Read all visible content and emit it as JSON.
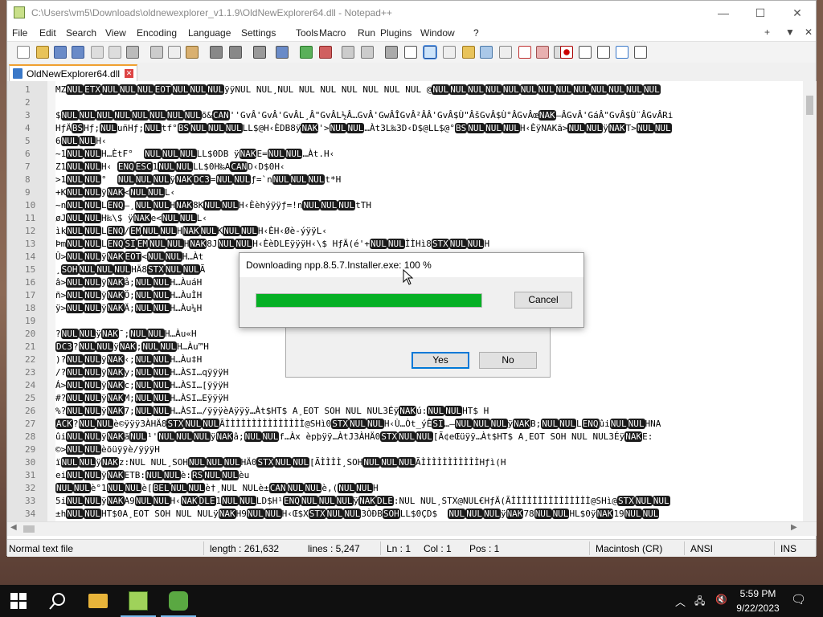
{
  "window": {
    "title": "C:\\Users\\vm5\\Downloads\\oldnewexplorer_v1.1.9\\OldNewExplorer64.dll - Notepad++"
  },
  "menu": [
    "File",
    "Edit",
    "Search",
    "View",
    "Encoding",
    "Language",
    "Settings",
    "Tools",
    "Macro",
    "Run",
    "Plugins",
    "Window",
    "?"
  ],
  "menu_right": [
    "+",
    "▼",
    "✕"
  ],
  "tab": {
    "label": "OldNewExplorer64.dll"
  },
  "editor": {
    "lines": [
      {
        "n": "1",
        "t": "MZ·NUL·ETX·NUL NUL NUL·EOT·NUL NUL NUL·ÿÿ·NUL NUL¸NUL NUL NUL NUL NUL NUL NUL @·NUL NUL NUL NUL NUL NUL NUL NUL NUL NUL NUL NUL NUL"
      },
      {
        "n": "2",
        "t": ""
      },
      {
        "n": "3",
        "t": "$·NUL NUL NUL NUL NUL NUL NUL NUL·õ&·CAN·''GvÂ'GvÂ'GvÂL¸Â\"GvÂL½Â…GvÂ'GwÂÎGvÂ²ÂÂ'GvÂ$Ù\"ÂšGvÂ$Ù°ÂGvÂœ·NAK·–ÂGvÂ'GáÂ\"GvÂ$Ù¨ÂGvÂRi"
      },
      {
        "n": "4",
        "t": "HƒÄ·BS·Hƒ;·NUL·uñHƒ;·NUL·tf°·BS·NUL NUL NUL·LL$@H‹ÈDB8ÿ·NAK·'>·NUL NUL·…Àt3L‰3D‹D$@LL$@°·BS·NUL NUL NUL·H‹ÈÿNAK·ã>·NUL NUL·ÿ·NAK·T>·NUL NUL"
      },
      {
        "n": "5",
        "t": "6·NUL NUL·H‹"
      },
      {
        "n": "6",
        "t": "~1·NUL NUL·H…ÈtF°  ·NUL NUL NUL·LL$0DB ÿ·NAK·E=·NUL NUL·…Àt.H‹"
      },
      {
        "n": "7",
        "t": "Z1·NUL NUL·H‹ ·ENQ ESC·1·NUL NUL·LL$0H‰A·CAN·D‹D$0H‹"
      },
      {
        "n": "8",
        "t": ">1·NUL NUL·°  ·NUL NUL NUL·ÿ·NAK DC3·=·NUL NUL·ƒ=`n·NUL NUL NUL·t*H"
      },
      {
        "n": "9",
        "t": "+K·NUL NUL·ÿ·NAK·<·NUL NUL·L‹"
      },
      {
        "n": "10",
        "t": "~n·NUL NUL·L·ENQ·–¸·NUL NUL·H·NAK·8K·NUL NUL·H‹Èèhýÿÿƒ=!n·NUL NUL NUL·tTH"
      },
      {
        "n": "11",
        "t": "øJ·NUL NUL·H‰\\$ ÿ·NAK·e<·NUL NUL·L‹"
      },
      {
        "n": "12",
        "t": "ìk·NUL NUL·L·ENQ·/·EM·NUL NUL·H·NAK NUL·K·NUL NUL·H‹ÈH‹Øè-ýÿÿL‹"
      },
      {
        "n": "13",
        "t": "Þm·NUL NUL·L·ENQ SI EM·NUL NUL·H·NAK·8J·NUL NUL·H‹ÈèDLE·ÿÿÿH‹\\$ HƒÄ(é'+·NUL NUL·ÌÌHì8·STX·NUL NUL·H"
      },
      {
        "n": "14",
        "t": "Û>·NUL NUL·ÿ·NAK EOT·<·NUL NUL·H…Àt"
      },
      {
        "n": "15",
        "t": "¸·SOH·NUL NUL NUL·HÄ8·STX·NUL NUL·Ã"
      },
      {
        "n": "16",
        "t": "â>·NUL NUL·ÿ·NAK·å;·NUL NUL·H…ÀuáH"
      },
      {
        "n": "17",
        "t": "ñ>·NUL NUL·ÿ·NAK·Ö;·NUL NUL·H…ÀuÌH"
      },
      {
        "n": "18",
        "t": "ÿ>·NUL NUL·ÿ·NAK·Ä;·NUL NUL·H…Àu¼H"
      },
      {
        "n": "19",
        "t": ""
      },
      {
        "n": "20",
        "t": "?·NUL NUL·ÿ·NAK·¯;·NUL NUL·H…Àu«H"
      },
      {
        "n": "21",
        "t": "DC3·?·NUL NUL·ÿ·NAK·;·NUL NUL·H…Àu™H"
      },
      {
        "n": "22",
        "t": ")?·NUL NUL·ÿ·NAK·‹;·NUL NUL·H…Àu‡H"
      },
      {
        "n": "23",
        "t": "/?·NUL NUL·ÿ·NAK·y;·NUL NUL·H…ÀSI…qÿÿÿH"
      },
      {
        "n": "24",
        "t": "Á>·NUL NUL·ÿ·NAK·c;·NUL NUL·H…ÀSI…[ÿÿÿH"
      },
      {
        "n": "25",
        "t": "#?·NUL NUL·ÿ·NAK·M;·NUL NUL·H…ÀSI…EÿÿÿH"
      },
      {
        "n": "26",
        "t": "%?·NUL NUL·ÿ·NAK·7;·NUL NUL·H…ÀSI…/ÿÿÿèAÿÿÿ…Àt$HT$ A¸EOT SOH NUL NUL·3Éÿ·NAK·ú:·NUL NUL·HT$ H"
      },
      {
        "n": "27",
        "t": "ACK·?·NUL NUL·è©ÿÿÿ3ÀHÄ8·STX NUL NUL·ÃÌÌÌÌÌÌÌÌÌÌÌÌÌÌÌ@SHì0·STX·NUL NUL·H‹Ù…Òt_ýÊ·SI·…–·NUL NUL NUL·ÿ·NAK·B;·NUL NUL·L·ENQ·ûi·NUL NUL·H·NA"
      },
      {
        "n": "28",
        "t": "ûi·NUL NUL·ÿ·NAK·ã·NUL·¹'·NUL NUL NUL·ÿ·NAK·â;·NUL NUL·f…Àx èpþÿÿ…ÀtJ3ÀHÄ0·STX NUL NUL·[Ã¢eŒüÿÿ…Àt$HT$ A¸EOT SOH NUL NUL·3Éÿ·NAK·E:"
      },
      {
        "n": "29",
        "t": "©>·NUL NUL·èõüÿÿè/ÿÿÿH"
      },
      {
        "n": "30",
        "t": "ï·NUL NUL·ÿ·NAK·z:·NUL NUL¸SOH·NUL NUL NUL·HÄ0·STX·NUL NUL·[ÃÌÌÌÌ¸SOH·NUL NUL NUL·ÃÌÌÌÌÌÌÌÌÌÌÌHƒì(H"
      },
      {
        "n": "31",
        "t": "ei·NUL NUL·ÿ·NAK·ETB:·NUL NUL·è:·RS·NUL NUL·èu"
      },
      {
        "n": "32",
        "t": "NUL NUL·è°1·NUL NUL·è[·BEL·NUL NUL·è†¸NUL NUL·è±·CAN·NUL NUL·è,(·NUL NUL·H"
      },
      {
        "n": "33",
        "t": "5i·NUL NUL·ÿ·NAK·A9·NUL NUL·H‹·NAK DLE·1·NUL NUL·LD$H¹·ENQ·NUL NUL NUL·ÿ·NAK DLE·:·NUL NUL¸STX·@NUL·€HƒÄ(ÃÌÌÌÌÌÌÌÌÌÌÌÌÌÌÌ@SHì@·STX·NUL NUL"
      },
      {
        "n": "34",
        "t": "±h·NUL NUL·HT$0A¸EOT SOH NUL NUL·ÿ·NAK·H9·NUL NUL·H‹Œ$X·STX·NUL NUL·3ÒÐB·SOH·LL$0ÇD$  ·NUL NUL NUL·ÿ·NAK·78·NUL NUL·HL$0ÿ·NAK·19·NUL NUL"
      }
    ]
  },
  "statusbar": {
    "type": "Normal text file",
    "length": "length : 261,632",
    "lines": "lines : 5,247",
    "ln": "Ln : 1",
    "col": "Col : 1",
    "pos": "Pos : 1",
    "eol": "Macintosh (CR)",
    "encoding": "ANSI",
    "mode": "INS"
  },
  "download_dialog": {
    "title": "Downloading npp.8.5.7.Installer.exe: 100 %",
    "progress": 1.0,
    "cancel": "Cancel"
  },
  "confirm_dialog": {
    "yes": "Yes",
    "no": "No"
  },
  "taskbar": {
    "time": "5:59 PM",
    "date": "9/22/2023"
  },
  "colors": {
    "progress": "#06b025",
    "taskbar": "#101010",
    "control_char_bg": "#1b1b1b"
  }
}
